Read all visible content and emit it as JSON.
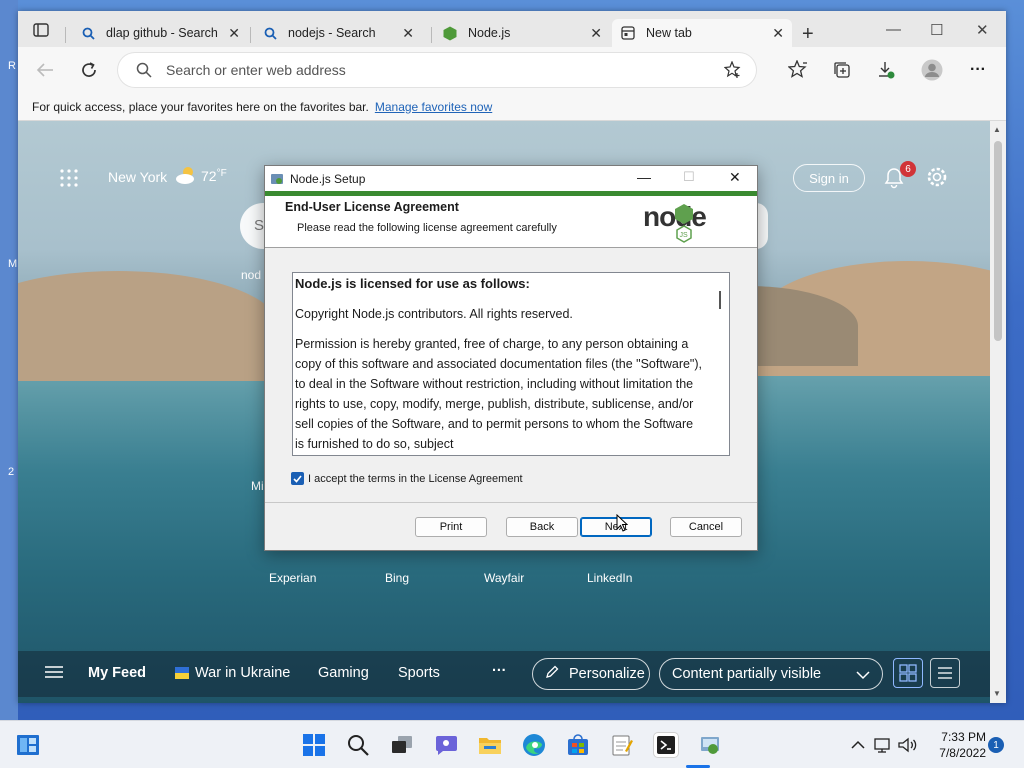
{
  "desktop": {
    "edge_marks": [
      "R",
      "M",
      "2"
    ]
  },
  "browser": {
    "tabs": [
      {
        "label": "dlap github - Search",
        "icon": "search-icon"
      },
      {
        "label": "nodejs - Search",
        "icon": "search-icon"
      },
      {
        "label": "Node.js",
        "icon": "nodejs-hexagon-icon"
      },
      {
        "label": "New tab",
        "icon": "newtab-page-icon",
        "active": true
      }
    ],
    "address": {
      "placeholder": "Search or enter web address"
    },
    "favbar": {
      "text": "For quick access, place your favorites here on the favorites bar.",
      "link": "Manage favorites now"
    }
  },
  "ntp": {
    "location": "New York",
    "temperature": "72",
    "temp_unit": "°F",
    "sign_in": "Sign in",
    "notification_count": "6",
    "fragments": {
      "s": "S",
      "nod": "nod",
      "mi": "Mi"
    },
    "quick_links": [
      "Experian",
      "Bing",
      "Wayfair",
      "LinkedIn"
    ],
    "feed": {
      "items": [
        "My Feed",
        "War in Ukraine",
        "Gaming",
        "Sports"
      ],
      "more": "···",
      "personalize": "Personalize",
      "content_select": "Content partially visible"
    }
  },
  "dialog": {
    "title": "Node.js Setup",
    "heading": "End-User License Agreement",
    "subheading": "Please read the following license agreement carefully",
    "license_title": "Node.js is licensed for use as follows:",
    "license_p1": "Copyright Node.js contributors. All rights reserved.",
    "license_p2": "Permission is hereby granted, free of charge, to any person obtaining a copy of this software and associated documentation files (the \"Software\"), to deal in the Software without restriction, including without limitation the rights to use, copy, modify, merge, publish, distribute, sublicense, and/or sell copies of the Software, and to permit persons to whom the Software is furnished to do so, subject",
    "accept_label": "I accept the terms in the License Agreement",
    "accept_checked": true,
    "buttons": {
      "print": "Print",
      "back": "Back",
      "next": "Next",
      "cancel": "Cancel"
    },
    "logo_text": "node",
    "logo_badge": "JS"
  },
  "taskbar": {
    "time": "7:33 PM",
    "date": "7/8/2022",
    "notifications": "1"
  },
  "colors": {
    "accent": "#0067c0",
    "node_green": "#3a8a30",
    "link": "#2064b8"
  }
}
